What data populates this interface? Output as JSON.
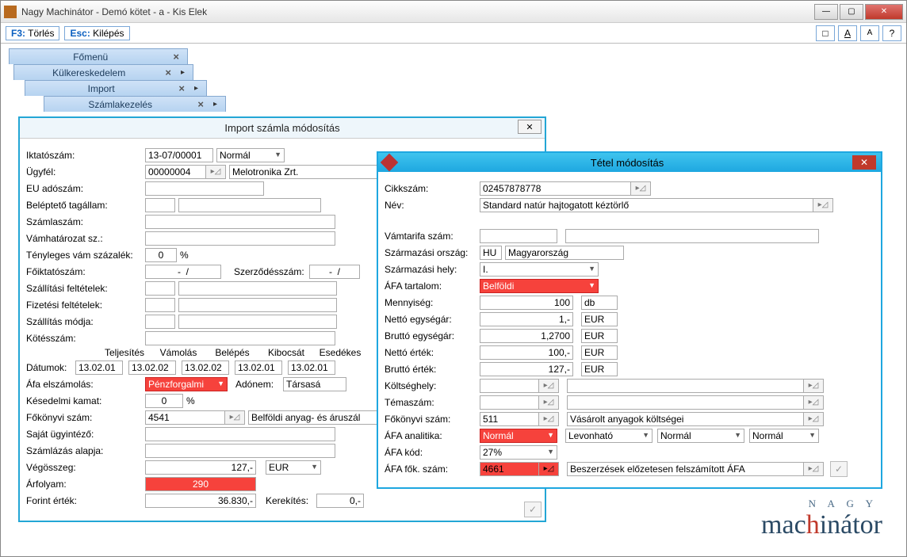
{
  "window": {
    "title": "Nagy Machinátor - Demó kötet - a - Kis Elek"
  },
  "toolbar": {
    "f3_key": "F3:",
    "f3_label": "Törlés",
    "esc_key": "Esc:",
    "esc_label": "Kilépés",
    "btn_sq": "□",
    "btn_a1": "A",
    "btn_a2": "A",
    "btn_help": "?"
  },
  "tabs": {
    "t1": "Főmenü",
    "t2": "Külkereskedelem",
    "t3": "Import",
    "t4": "Számlakezelés"
  },
  "import": {
    "title": "Import számla módosítás",
    "labels": {
      "iktatoszam": "Iktatószám:",
      "ugyfel": "Ügyfél:",
      "eu_adoszam": "EU adószám:",
      "belepteto": "Beléptető tagállam:",
      "szamlaszam": "Számlaszám:",
      "vamhatarozat": "Vámhatározat sz.:",
      "tenyleges_vam": "Tényleges vám százalék:",
      "foiktatoszam": "Főiktatószám:",
      "szerzodesszam": "Szerződésszám:",
      "szall_felt": "Szállítási feltételek:",
      "fiz_felt": "Fizetési feltételek:",
      "szall_mod": "Szállítás módja:",
      "kotesszam": "Kötésszám:",
      "datumok": "Dátumok:",
      "teljesites": "Teljesítés",
      "vamolas": "Vámolás",
      "belepes": "Belépés",
      "kibocsat": "Kibocsát",
      "esedekes": "Esedékes",
      "afa_elsz": "Áfa elszámolás:",
      "adonem": "Adónem:",
      "kesedelmi": "Késedelmi kamat:",
      "fokonyvi": "Főkönyvi szám:",
      "sajat_ugy": "Saját ügyintéző:",
      "szamlazas": "Számlázás alapja:",
      "vegosszeg": "Végösszeg:",
      "arfolyam": "Árfolyam:",
      "forint": "Forint érték:",
      "kerekites": "Kerekítés:",
      "pct": "%"
    },
    "values": {
      "iktatoszam": "13-07/00001",
      "normal": "Normál",
      "ugyfel_kod": "00000004",
      "ugyfel_nev": "Melotronika Zrt.",
      "vam_pct": "0",
      "foiktatoszam": "-  /",
      "szerzodesszam": "-  /",
      "d_teljesites": "13.02.01",
      "d_vamolas": "13.02.02",
      "d_belepes": "13.02.02",
      "d_kibocsat": "13.02.01",
      "d_esedekes": "13.02.01",
      "afa_mode": "Pénzforgalmi",
      "adonem": "Társasá",
      "kesedelmi": "0",
      "fokonyvi": "4541",
      "fokonyvi_nev": "Belföldi anyag- és áruszál",
      "vegosszeg": "127,-",
      "penznem": "EUR",
      "arfolyam": "290",
      "forint": "36.830,-",
      "kerekites": "0,-"
    }
  },
  "tetel": {
    "title": "Tétel módosítás",
    "labels": {
      "cikkszam": "Cikkszám:",
      "nev": "Név:",
      "vamtarifa": "Vámtarifa szám:",
      "szarm_orszag": "Származási ország:",
      "szarm_hely": "Származási hely:",
      "afa_tartalom": "ÁFA tartalom:",
      "mennyiseg": "Mennyiség:",
      "netto_egys": "Nettó egységár:",
      "brutto_egys": "Bruttó egységár:",
      "netto_ertek": "Nettó érték:",
      "brutto_ertek": "Bruttó érték:",
      "koltseghely": "Költséghely:",
      "temaszam": "Témaszám:",
      "fokonyvi": "Főkönyvi szám:",
      "afa_analitika": "ÁFA analitika:",
      "afa_kod": "ÁFA kód:",
      "afa_fok": "ÁFA fők. szám:"
    },
    "values": {
      "cikkszam": "02457878778",
      "nev": "Standard natúr hajtogatott kéztörlő",
      "orszag_kod": "HU",
      "orszag_nev": "Magyarország",
      "hely": "I.",
      "afa_tartalom": "Belföldi",
      "mennyiseg": "100",
      "me": "db",
      "netto_egys": "1,-",
      "brutto_egys": "1,2700",
      "netto_ertek": "100,-",
      "brutto_ertek": "127,-",
      "penznem": "EUR",
      "fokonyvi": "511",
      "fokonyvi_nev": "Vásárolt anyagok költségei",
      "analitika1": "Normál",
      "analitika2": "Levonható",
      "analitika3": "Normál",
      "analitika4": "Normál",
      "afa_kod": "27%",
      "afa_fok": "4661",
      "afa_fok_nev": "Beszerzések előzetesen felszámított ÁFA"
    }
  },
  "brand": {
    "small": "N A G Y",
    "main1": "mac",
    "main2": "h",
    "main3": "i",
    "main4": "nátor"
  }
}
